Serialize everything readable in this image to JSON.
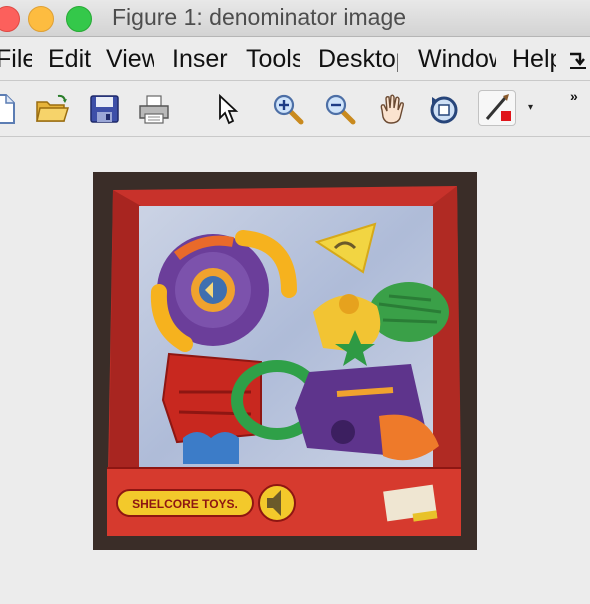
{
  "window": {
    "title": "Figure 1: denominator image"
  },
  "menubar": {
    "items": [
      {
        "label": "File"
      },
      {
        "label": "Edit"
      },
      {
        "label": "View"
      },
      {
        "label": "Insert"
      },
      {
        "label": "Tools"
      },
      {
        "label": "Desktop"
      },
      {
        "label": "Window"
      },
      {
        "label": "Help"
      }
    ]
  },
  "toolbar": {
    "buttons": [
      {
        "icon": "new-file-icon"
      },
      {
        "icon": "open-folder-icon"
      },
      {
        "icon": "save-icon"
      },
      {
        "icon": "print-icon"
      },
      {
        "icon": "pointer-arrow-icon"
      },
      {
        "icon": "zoom-in-icon"
      },
      {
        "icon": "zoom-out-icon"
      },
      {
        "icon": "pan-hand-icon"
      },
      {
        "icon": "rotate-3d-icon"
      },
      {
        "icon": "brush-icon"
      }
    ],
    "overflow_glyph": "»",
    "dropdown_glyph": "▾"
  },
  "figure": {
    "box_brand_text": "SHELCORE TOYS.",
    "colors": {
      "box_red": "#c8322b",
      "background": "#ececec"
    }
  }
}
